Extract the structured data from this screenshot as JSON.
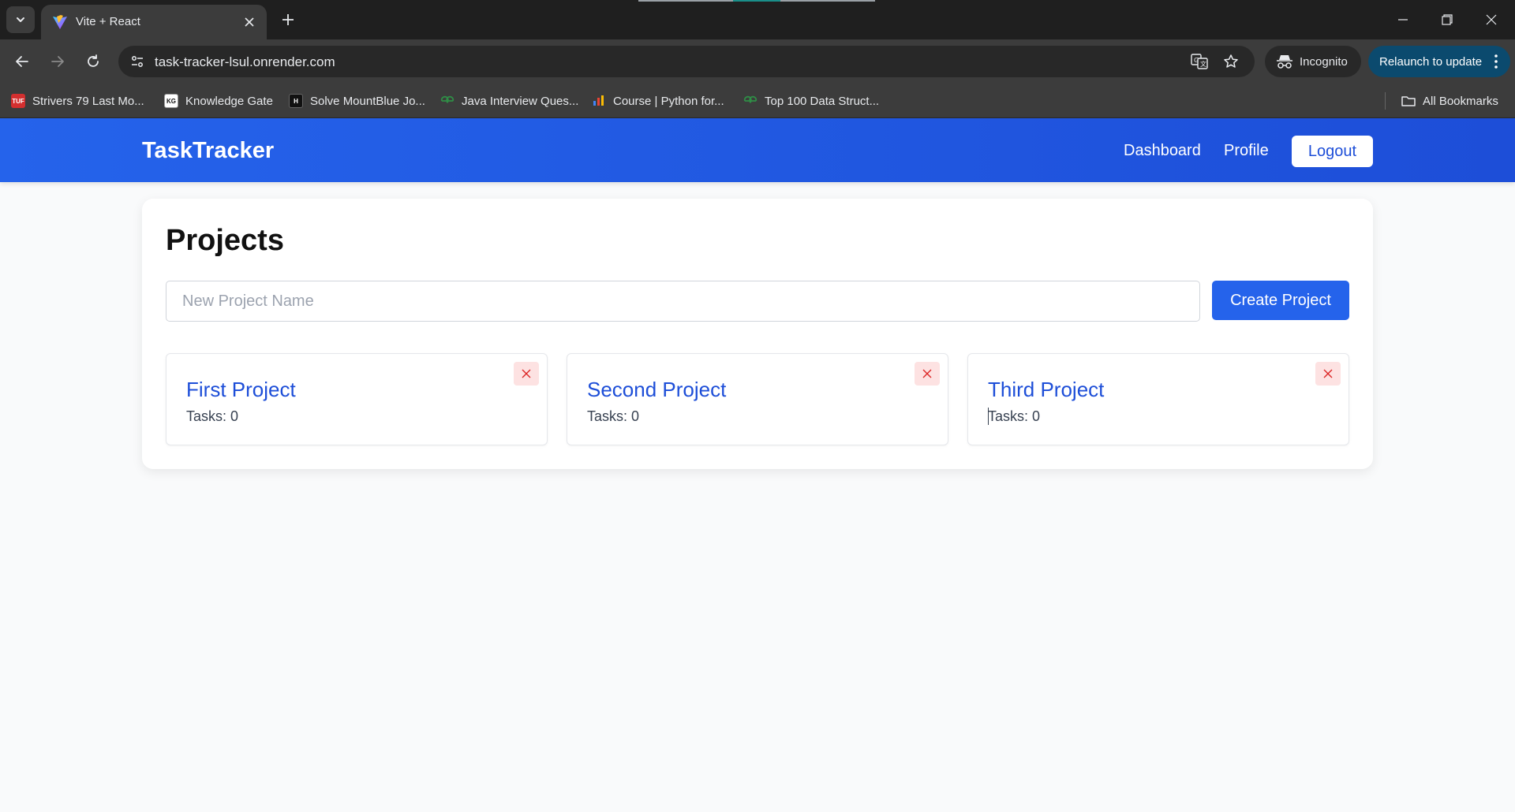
{
  "browser": {
    "tab": {
      "title": "Vite + React"
    },
    "url": "task-tracker-lsul.onrender.com",
    "incognito_label": "Incognito",
    "relaunch_label": "Relaunch to update",
    "bookmarks": [
      {
        "label": "Strivers 79 Last Mo...",
        "icon": "tuf-icon",
        "icon_text": "TUF",
        "color": "#d32f2f"
      },
      {
        "label": "Knowledge Gate",
        "icon": "knowledge-gate-icon",
        "icon_text": "KG",
        "color": "#ffffff"
      },
      {
        "label": "Solve MountBlue Jo...",
        "icon": "hackerearth-icon",
        "icon_text": "H",
        "color": "#111111"
      },
      {
        "label": "Java Interview Ques...",
        "icon": "geeksforgeeks-icon",
        "icon_text": "",
        "color": "#2f8d46"
      },
      {
        "label": "Course | Python for...",
        "icon": "course-icon",
        "icon_text": "",
        "color": "#4285f4"
      },
      {
        "label": "Top 100 Data Struct...",
        "icon": "geeksforgeeks-icon",
        "icon_text": "",
        "color": "#2f8d46"
      }
    ],
    "all_bookmarks_label": "All Bookmarks"
  },
  "app": {
    "brand": "TaskTracker",
    "nav": {
      "dashboard": "Dashboard",
      "profile": "Profile",
      "logout": "Logout"
    },
    "page_title": "Projects",
    "new_project": {
      "placeholder": "New Project Name",
      "value": "",
      "button": "Create Project"
    },
    "projects": [
      {
        "name": "First Project",
        "tasks": "Tasks: 0"
      },
      {
        "name": "Second Project",
        "tasks": "Tasks: 0"
      },
      {
        "name": "Third Project",
        "tasks": "Tasks: 0"
      }
    ]
  },
  "colors": {
    "primary": "#2563eb",
    "primary_dark": "#1d4ed8",
    "danger_bg": "#fde2e2",
    "danger": "#dc2626",
    "page_bg": "#f9fafb"
  }
}
